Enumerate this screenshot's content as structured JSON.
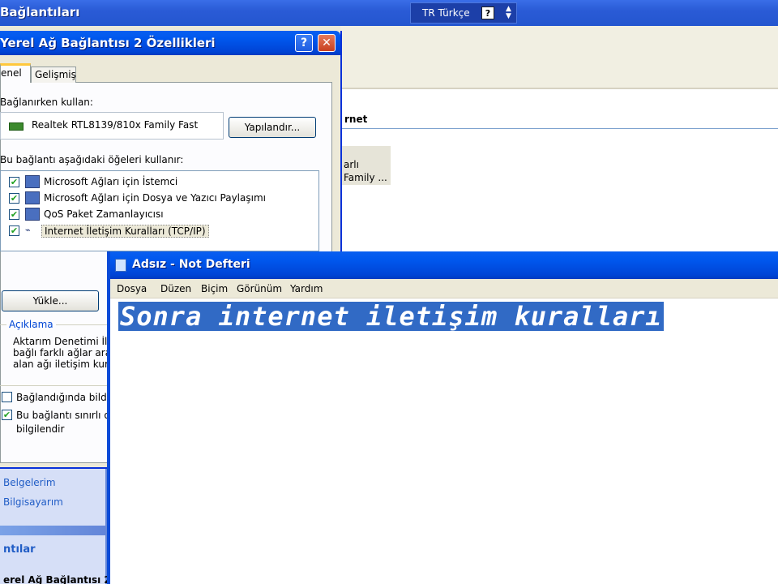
{
  "background_window": {
    "title": "Bağlantıları",
    "language_bar": {
      "lang": "TR Türkçe",
      "help": "?"
    },
    "group_header": "rnet",
    "connection": {
      "status": "arlı",
      "adapter": "Family ..."
    },
    "sidebar": {
      "links": [
        "Belgelerim",
        "Bilgisayarım"
      ],
      "header": "ntılar",
      "detail": "erel Ağ Bağlantısı 2"
    }
  },
  "properties_dialog": {
    "title": "Yerel Ağ Bağlantısı 2 Özellikleri",
    "tabs": [
      "enel",
      "Gelişmiş"
    ],
    "connect_using_label": "Bağlanırken kullan:",
    "adapter_name": "Realtek RTL8139/810x Family Fast",
    "configure_button": "Yapılandır...",
    "items_label": "Bu bağlantı aşağıdaki öğeleri kullanır:",
    "components": [
      {
        "label": "Microsoft Ağları için İstemci",
        "checked": true
      },
      {
        "label": "Microsoft Ağları için Dosya ve Yazıcı Paylaşımı",
        "checked": true
      },
      {
        "label": "QoS Paket Zamanlayıcısı",
        "checked": true
      },
      {
        "label": "Internet İletişim Kuralları (TCP/IP)",
        "checked": true
      }
    ],
    "install_button": "Yükle...",
    "description_legend": "Açıklama",
    "description_lines": [
      "Aktarım Denetimi İle",
      "bağlı farklı ağlar aras",
      "alan ağı iletişim kura"
    ],
    "option_notify": "Bağlandığında bildi",
    "option_limited": [
      "Bu bağlantı sınırlı ol",
      "bilgilendir"
    ]
  },
  "notepad": {
    "title": "Adsız - Not Defteri",
    "menu": [
      "Dosya",
      "Düzen",
      "Biçim",
      "Görünüm",
      "Yardım"
    ],
    "text": "Sonra internet iletişim kuralları"
  }
}
